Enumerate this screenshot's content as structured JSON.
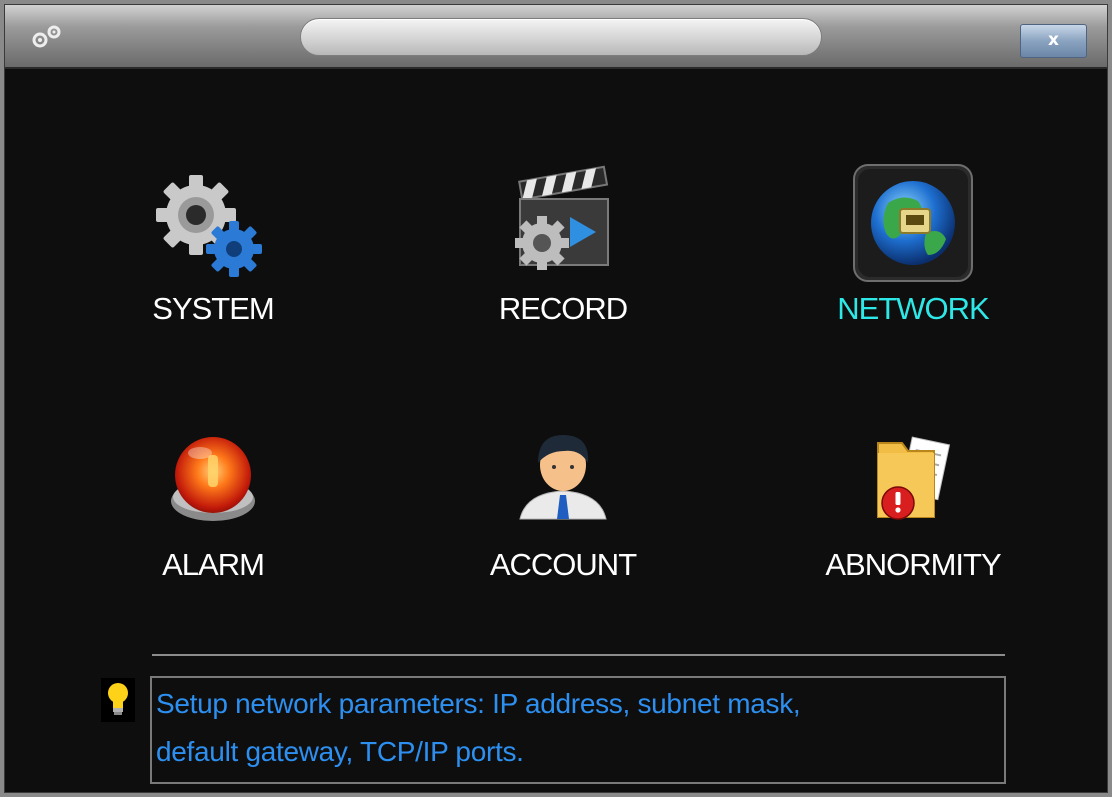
{
  "window": {
    "title_bar_text": "",
    "close_label": "x"
  },
  "menu": {
    "items": [
      {
        "label": "SYSTEM",
        "icon": "gears-icon",
        "selected": false
      },
      {
        "label": "RECORD",
        "icon": "clapperboard-icon",
        "selected": false
      },
      {
        "label": "NETWORK",
        "icon": "globe-network-icon",
        "selected": true
      },
      {
        "label": "ALARM",
        "icon": "alarm-light-icon",
        "selected": false
      },
      {
        "label": "ACCOUNT",
        "icon": "user-icon",
        "selected": false
      },
      {
        "label": "ABNORMITY",
        "icon": "folder-warning-icon",
        "selected": false
      }
    ]
  },
  "hint": {
    "icon": "lightbulb-icon",
    "line1": "Setup network parameters: IP address, subnet mask,",
    "line2": "default gateway, TCP/IP ports."
  },
  "colors": {
    "background": "#0e0e0e",
    "label": "#ffffff",
    "selected_label": "#2ee8e8",
    "hint_text": "#2d8ff0"
  }
}
